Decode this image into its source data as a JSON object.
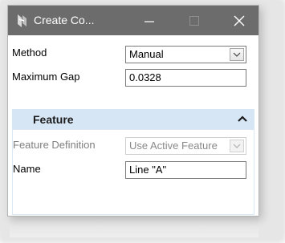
{
  "window": {
    "title": "Create Co...",
    "minimize_glyph": "—",
    "close_glyph": "✕"
  },
  "form": {
    "method_label": "Method",
    "method_value": "Manual",
    "max_gap_label": "Maximum Gap",
    "max_gap_value": "0.0328"
  },
  "feature_section": {
    "title": "Feature",
    "feature_definition_label": "Feature Definition",
    "feature_definition_value": "Use Active Feature",
    "name_label": "Name",
    "name_value": "Line \"A\""
  },
  "colors": {
    "titlebar": "#6c6c6c",
    "section_header": "#d7e6f5",
    "field_border": "#7a7a7a",
    "disabled_text": "#7f7f7f"
  },
  "icons": {
    "app": "bentley-app-icon",
    "minimize": "minimize-icon",
    "maximize": "maximize-icon",
    "close": "close-icon",
    "dropdown": "chevron-down-icon",
    "collapse": "chevron-up-icon"
  }
}
